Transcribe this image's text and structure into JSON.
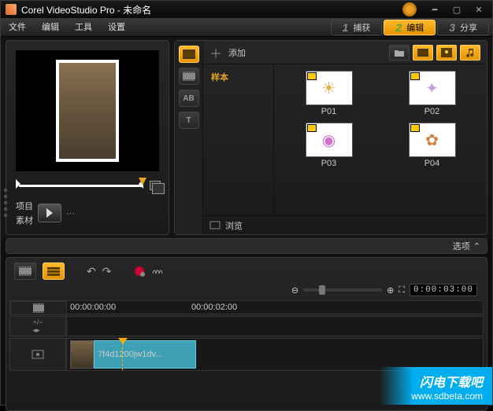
{
  "title": "Corel VideoStudio Pro - 未命名",
  "menu": {
    "file": "文件",
    "edit": "编辑",
    "tools": "工具",
    "settings": "设置"
  },
  "steps": {
    "s1": {
      "num": "1",
      "label": "捕获"
    },
    "s2": {
      "num": "2",
      "label": "编辑"
    },
    "s3": {
      "num": "3",
      "label": "分享"
    }
  },
  "preview": {
    "project": "项目",
    "media": "素材"
  },
  "library": {
    "add": "添加",
    "sample": "样本",
    "browse": "浏览",
    "thumbs": [
      {
        "name": "P01"
      },
      {
        "name": "P02"
      },
      {
        "name": "P03"
      },
      {
        "name": "P04"
      }
    ]
  },
  "options": "选项",
  "timeline": {
    "timecode": "0:00:03:00",
    "ruler": [
      "00:00:00:00",
      "00:00:02:00"
    ],
    "clip_name": "7f4d1200jw1dv..."
  },
  "watermark": {
    "line1": "闪电下载吧",
    "line2": "www.sdbeta.com"
  }
}
